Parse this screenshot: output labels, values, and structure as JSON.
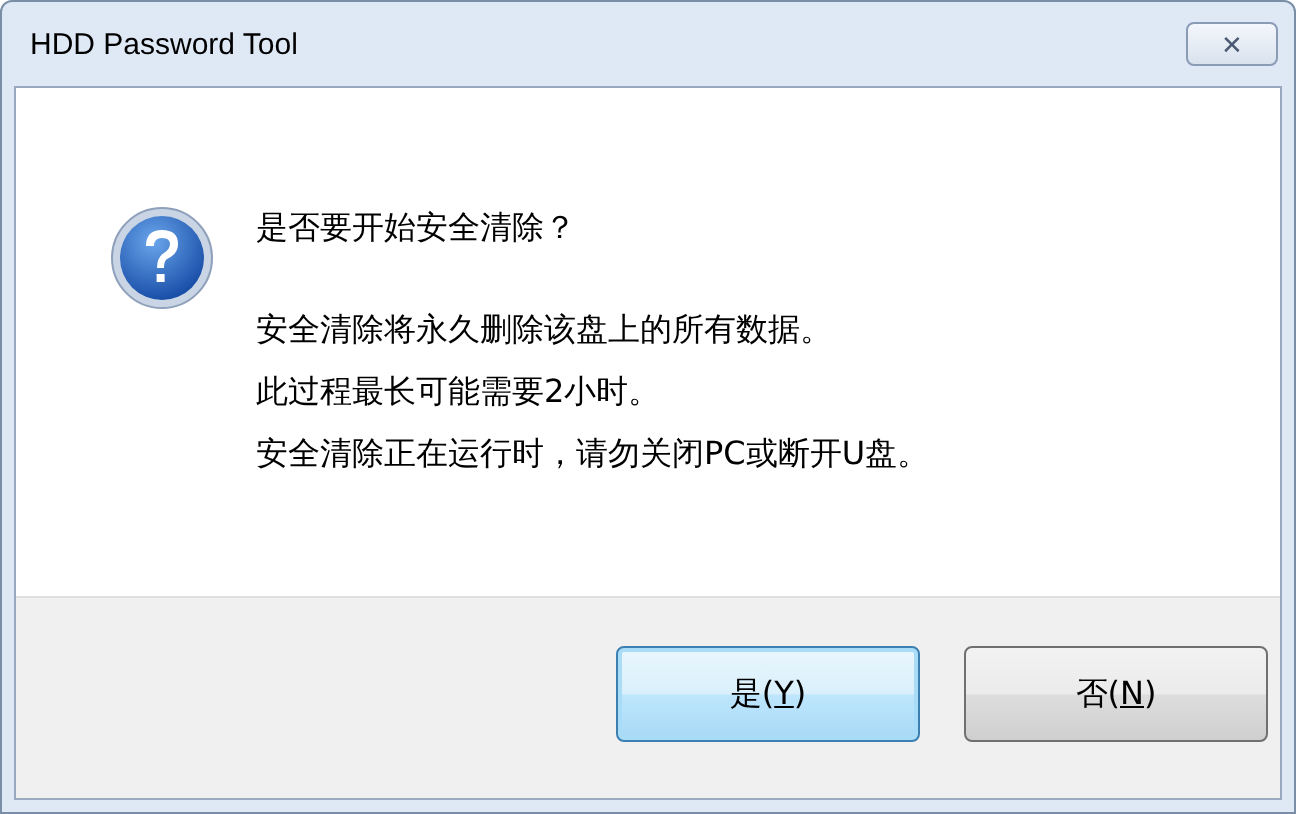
{
  "window": {
    "title": "HDD Password Tool",
    "close_label": "✕"
  },
  "message": {
    "heading": "是否要开始安全清除？",
    "lines": [
      "安全清除将永久删除该盘上的所有数据。",
      "此过程最长可能需要2小时。",
      "安全清除正在运行时，请勿关闭PC或断开U盘。"
    ]
  },
  "buttons": [
    {
      "before": "是(",
      "mnemonic": "Y",
      "after": ")",
      "selected": true
    },
    {
      "before": "否(",
      "mnemonic": "N",
      "after": ")",
      "selected": false
    }
  ]
}
